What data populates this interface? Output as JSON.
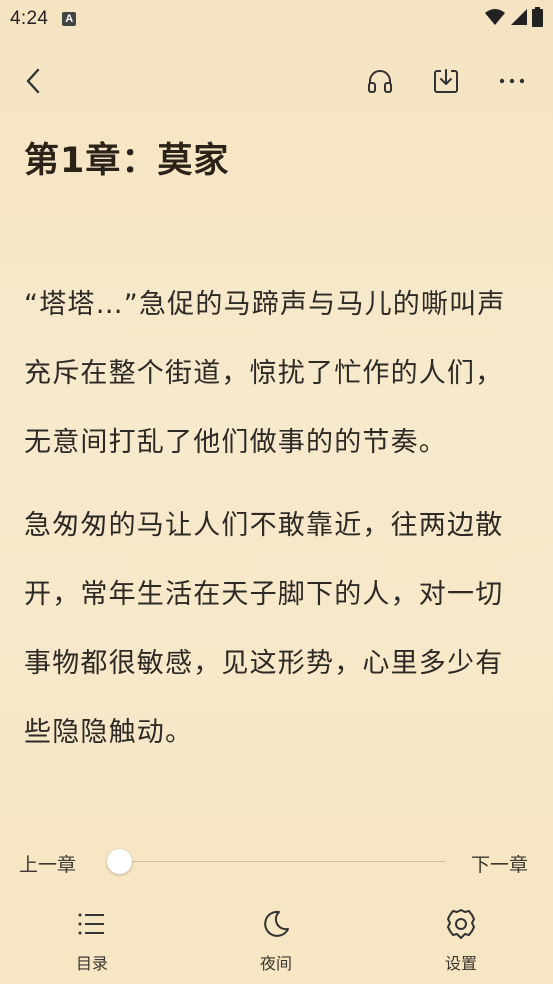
{
  "status_bar": {
    "time": "4:24",
    "notification_icon": "a-box-icon",
    "icons": [
      "wifi-icon",
      "signal-icon",
      "battery-icon"
    ]
  },
  "top_bar": {
    "back_icon": "chevron-left-icon",
    "listen_icon": "headphones-icon",
    "download_icon": "download-icon",
    "more_icon": "more-horizontal-icon"
  },
  "chapter": {
    "title": "第1章：莫家",
    "paragraphs": [
      "“塔塔…”急促的马蹄声与马儿的嘶叫声充斥在整个街道，惊扰了忙作的人们，无意间打乱了他们做事的的节奏。",
      "急匆匆的马让人们不敢靠近，往两边散开，常年生活在天子脚下的人，对一切事物都很敏感，见这形势，心里多少有些隐隐触动。"
    ]
  },
  "controls": {
    "prev_chapter": "上一章",
    "next_chapter": "下一章",
    "progress": 0.0,
    "tabs": [
      {
        "label": "目录",
        "icon": "list-icon"
      },
      {
        "label": "夜间",
        "icon": "moon-icon"
      },
      {
        "label": "设置",
        "icon": "gear-icon"
      }
    ]
  },
  "colors": {
    "background": "#f6e7c8",
    "text": "#2d2a25",
    "thumb": "#ffffff"
  }
}
